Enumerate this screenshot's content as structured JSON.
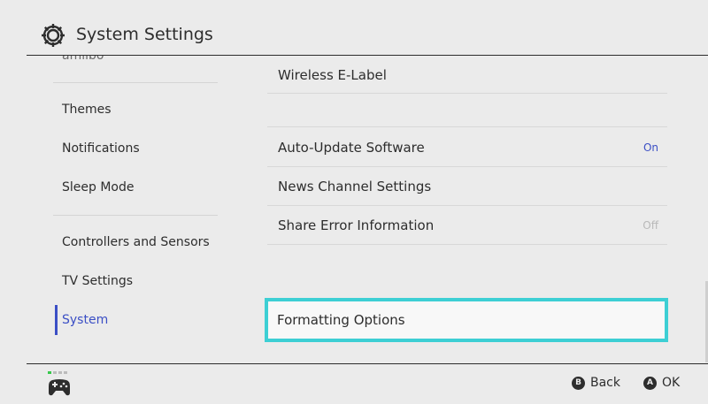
{
  "header": {
    "title": "System Settings",
    "icon": "gear-icon"
  },
  "sidebar": {
    "partial_item": "amiibo",
    "items": [
      {
        "label": "Themes"
      },
      {
        "label": "Notifications"
      },
      {
        "label": "Sleep Mode"
      },
      {
        "label": "Controllers and Sensors"
      },
      {
        "label": "TV Settings"
      },
      {
        "label": "System",
        "active": true
      }
    ]
  },
  "main": {
    "rows": [
      {
        "label": "Wireless E-Label",
        "value": ""
      },
      {
        "label": "Auto-Update Software",
        "value": "On"
      },
      {
        "label": "News Channel Settings",
        "value": ""
      },
      {
        "label": "Share Error Information",
        "value": "Off"
      }
    ],
    "focused": {
      "label": "Formatting Options"
    }
  },
  "footer": {
    "controller_icon": "controller-icon",
    "back": {
      "button": "B",
      "label": "Back"
    },
    "ok": {
      "button": "A",
      "label": "OK"
    }
  },
  "colors": {
    "background": "#ebebeb",
    "accent": "#3b4fc5",
    "focus": "#3dcfd4",
    "text": "#2d2d2d"
  }
}
